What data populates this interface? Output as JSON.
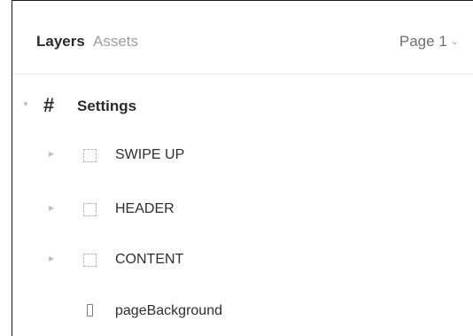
{
  "tabs": {
    "layers_label": "Layers",
    "assets_label": "Assets",
    "page_label": "Page 1"
  },
  "layers": [
    {
      "label": "Settings",
      "kind": "frame"
    },
    {
      "label": "SWIPE UP",
      "kind": "group"
    },
    {
      "label": "HEADER",
      "kind": "group"
    },
    {
      "label": "CONTENT",
      "kind": "group"
    },
    {
      "label": "pageBackground",
      "kind": "rectangle"
    }
  ],
  "colors": {
    "text_primary": "#2b2b2b",
    "text_muted": "#9d9d9d",
    "divider": "#e8e8e8"
  },
  "icons": {
    "frame": "hash-icon",
    "group": "dashed-group-icon",
    "rectangle": "rectangle-icon",
    "expand": "caret-right-icon",
    "collapse": "caret-down-icon"
  }
}
